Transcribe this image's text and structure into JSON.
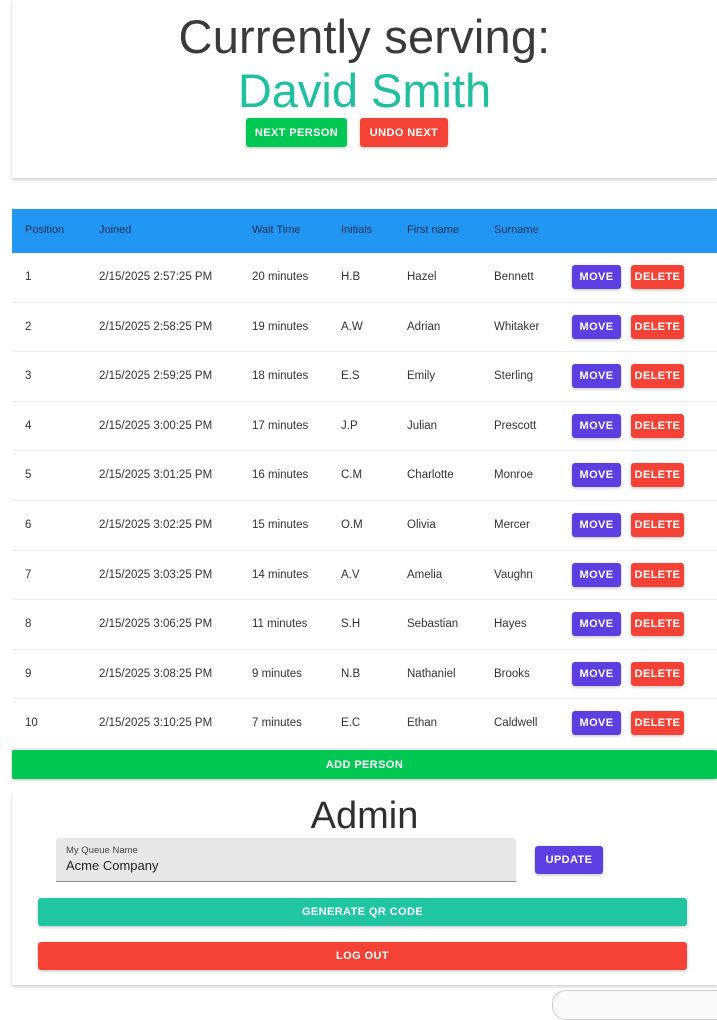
{
  "serving": {
    "title": "Currently serving:",
    "name": "David Smith",
    "next_label": "NEXT PERSON",
    "undo_label": "UNDO NEXT"
  },
  "table": {
    "headers": [
      "Position",
      "Joined",
      "Wait Time",
      "Initials",
      "First name",
      "Surname"
    ],
    "move_label": "MOVE",
    "delete_label": "DELETE",
    "rows": [
      {
        "position": "1",
        "joined": "2/15/2025 2:57:25 PM",
        "wait": "20 minutes",
        "initials": "H.B",
        "first": "Hazel",
        "surname": "Bennett"
      },
      {
        "position": "2",
        "joined": "2/15/2025 2:58:25 PM",
        "wait": "19 minutes",
        "initials": "A.W",
        "first": "Adrian",
        "surname": "Whitaker"
      },
      {
        "position": "3",
        "joined": "2/15/2025 2:59:25 PM",
        "wait": "18 minutes",
        "initials": "E.S",
        "first": "Emily",
        "surname": "Sterling"
      },
      {
        "position": "4",
        "joined": "2/15/2025 3:00:25 PM",
        "wait": "17 minutes",
        "initials": "J.P",
        "first": "Julian",
        "surname": "Prescott"
      },
      {
        "position": "5",
        "joined": "2/15/2025 3:01:25 PM",
        "wait": "16 minutes",
        "initials": "C.M",
        "first": "Charlotte",
        "surname": "Monroe"
      },
      {
        "position": "6",
        "joined": "2/15/2025 3:02:25 PM",
        "wait": "15 minutes",
        "initials": "O.M",
        "first": "Olivia",
        "surname": "Mercer"
      },
      {
        "position": "7",
        "joined": "2/15/2025 3:03:25 PM",
        "wait": "14 minutes",
        "initials": "A.V",
        "first": "Amelia",
        "surname": "Vaughn"
      },
      {
        "position": "8",
        "joined": "2/15/2025 3:06:25 PM",
        "wait": "11 minutes",
        "initials": "S.H",
        "first": "Sebastian",
        "surname": "Hayes"
      },
      {
        "position": "9",
        "joined": "2/15/2025 3:08:25 PM",
        "wait": "9 minutes",
        "initials": "N.B",
        "first": "Nathaniel",
        "surname": "Brooks"
      },
      {
        "position": "10",
        "joined": "2/15/2025 3:10:25 PM",
        "wait": "7 minutes",
        "initials": "E.C",
        "first": "Ethan",
        "surname": "Caldwell"
      }
    ],
    "add_label": "ADD PERSON"
  },
  "admin": {
    "title": "Admin",
    "queue_label": "My Queue Name",
    "queue_value": "Acme Company",
    "update_label": "UPDATE",
    "qr_label": "GENERATE QR CODE",
    "logout_label": "LOG OUT"
  },
  "colors": {
    "accent_teal": "#1fbf9f",
    "header_blue": "#2196f3",
    "green": "#00c853",
    "red": "#f44336",
    "purple": "#5b3fe0"
  }
}
